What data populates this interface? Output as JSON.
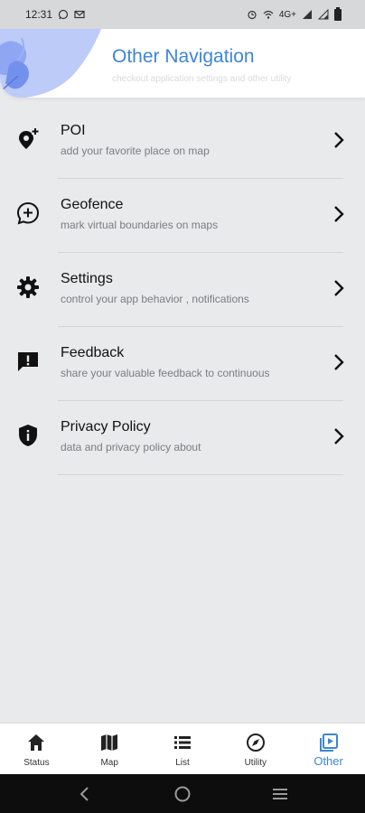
{
  "status_bar": {
    "time": "12:31",
    "network": "4G+"
  },
  "header": {
    "title": "Other Navigation",
    "subtitle": "checkout application settings and other utility"
  },
  "nav_items": [
    {
      "title": "POI",
      "description": "add your favorite place on map",
      "icon": "add-location-icon"
    },
    {
      "title": "Geofence",
      "description": "mark virtual boundaries on maps",
      "icon": "add-circle-chat-icon"
    },
    {
      "title": "Settings",
      "description": "control your app behavior , notifications",
      "icon": "gear-icon"
    },
    {
      "title": "Feedback",
      "description": "share your valuable feedback to continuous",
      "icon": "feedback-icon"
    },
    {
      "title": "Privacy Policy",
      "description": "data and privacy policy about",
      "icon": "shield-info-icon"
    }
  ],
  "bottom_nav": {
    "tabs": [
      {
        "label": "Status",
        "icon": "home-icon",
        "active": false
      },
      {
        "label": "Map",
        "icon": "map-icon",
        "active": false
      },
      {
        "label": "List",
        "icon": "list-icon",
        "active": false
      },
      {
        "label": "Utility",
        "icon": "compass-icon",
        "active": false
      },
      {
        "label": "Other",
        "icon": "video-library-icon",
        "active": true
      }
    ]
  },
  "colors": {
    "accent": "#3d86d6",
    "background": "#e9eaec",
    "header_art": "#9fb3f5"
  }
}
